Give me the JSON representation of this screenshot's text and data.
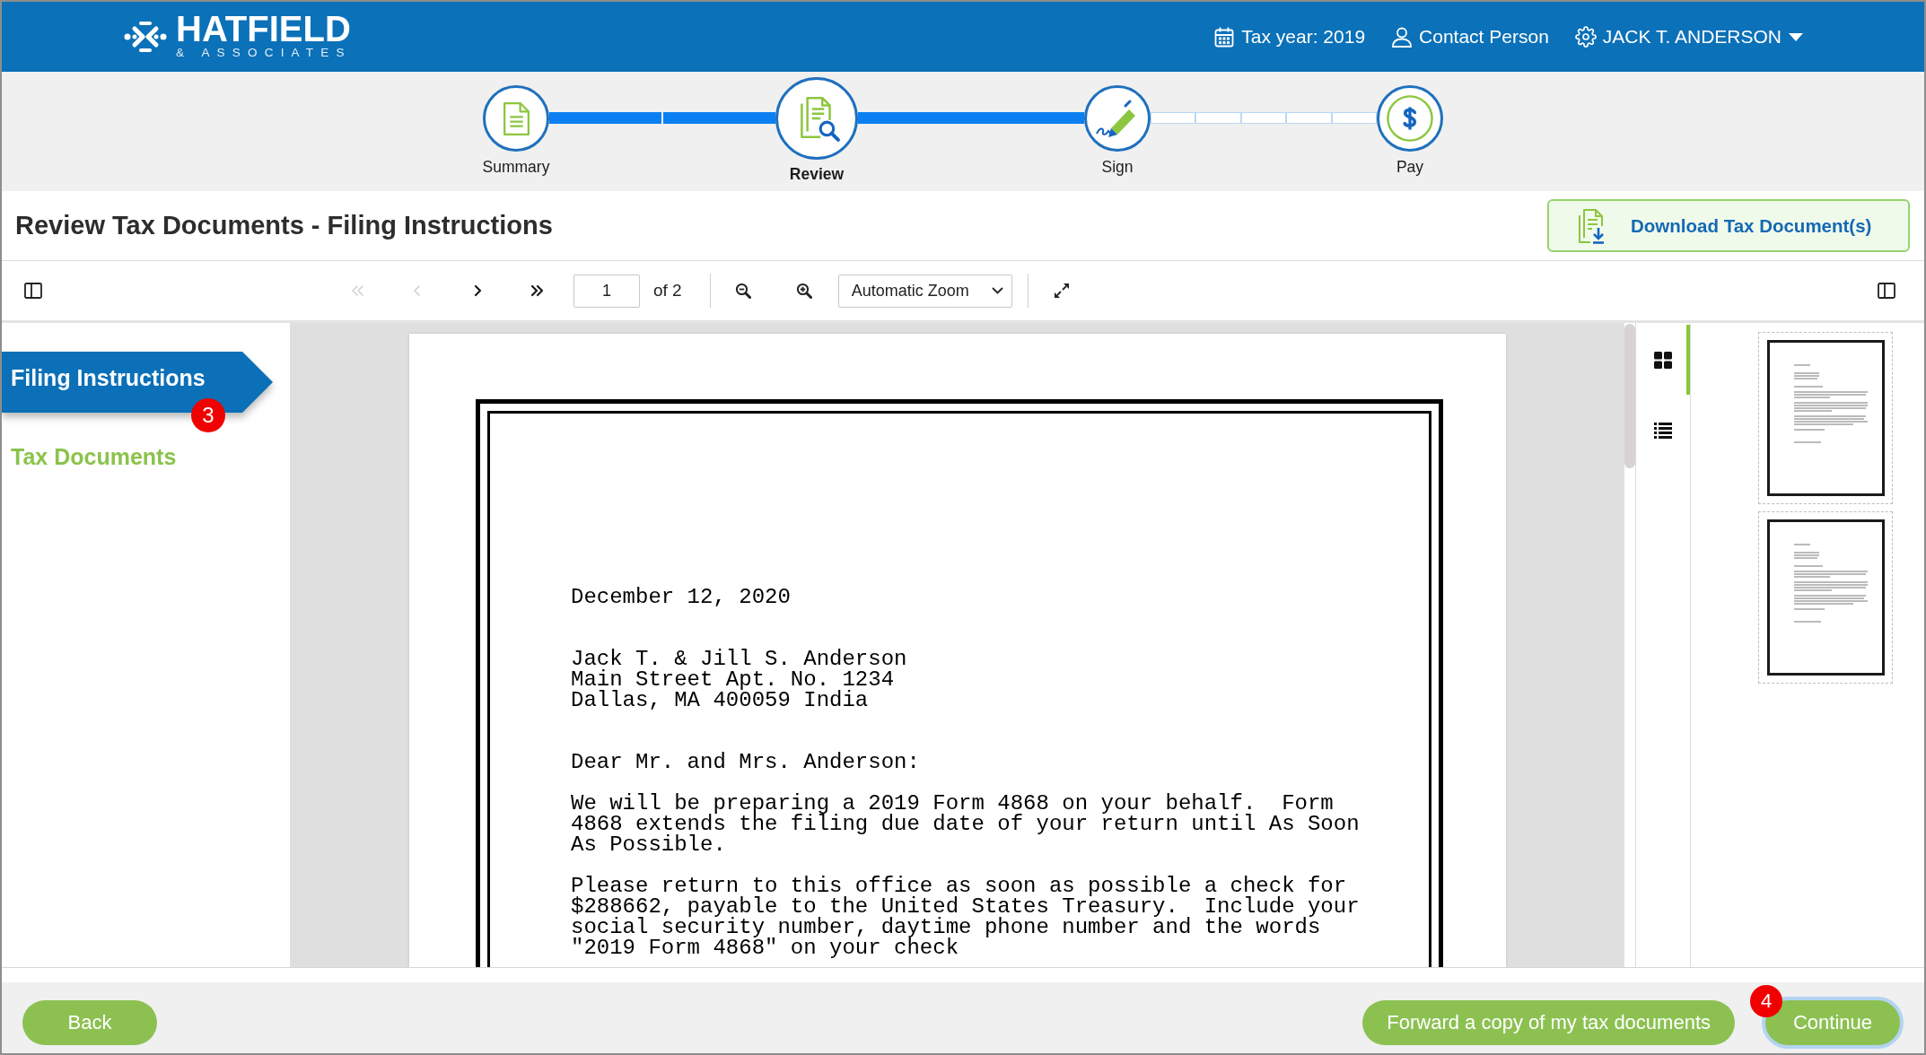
{
  "header": {
    "logo": {
      "name": "HATFIELD",
      "tagline": "& ASSOCIATES"
    },
    "tax_year": "Tax year: 2019",
    "contact": "Contact Person",
    "user": "JACK T. ANDERSON"
  },
  "steps": [
    {
      "kind": "summary",
      "label": "Summary",
      "selected": false
    },
    {
      "kind": "review",
      "label": "Review",
      "selected": true
    },
    {
      "kind": "sign",
      "label": "Sign",
      "selected": false
    },
    {
      "kind": "pay",
      "label": "Pay",
      "selected": false
    }
  ],
  "connectors": [
    {
      "filled": true
    },
    {
      "filled": true
    },
    {
      "filled": false
    }
  ],
  "page_title": "Review Tax Documents - Filing Instructions",
  "download_button": "Download Tax Document(s)",
  "viewer_toolbar": {
    "nav_buttons": [
      {
        "kind": "first",
        "disabled": true
      },
      {
        "kind": "previous",
        "disabled": true
      },
      {
        "kind": "next",
        "disabled": false
      },
      {
        "kind": "last",
        "disabled": false
      }
    ],
    "page_number": "1",
    "page_count": "of 2",
    "zoom": "Automatic Zoom"
  },
  "sidebar": [
    {
      "label": "Filing Instructions",
      "selected": true,
      "badge": "3"
    },
    {
      "label": "Tax Documents",
      "selected": false
    }
  ],
  "document": {
    "paragraphs": [
      "December 12, 2020",
      "Jack T. & Jill S. Anderson\nMain Street Apt. No. 1234\nDallas, MA 400059 India",
      "Dear Mr. and Mrs. Anderson:",
      "We will be preparing a 2019 Form 4868 on your behalf.  Form\n4868 extends the filing due date of your return until As Soon\nAs Possible.",
      "Please return to this office as soon as possible a check for\n$288662, payable to the United States Treasury.  Include your\nsocial security number, daytime phone number and the words\n\"2019 Form 4868\" on your check"
    ]
  },
  "thumbnail_views": [
    {
      "kind": "grid",
      "selected": true
    },
    {
      "kind": "list",
      "selected": false
    }
  ],
  "thumbnails": [
    {
      "selected": false
    },
    {
      "selected": false
    }
  ],
  "footer_buttons": [
    {
      "label": "Back",
      "focused": false
    },
    {
      "label": "Forward a copy of my tax documents",
      "focused": false
    },
    {
      "label": "Continue",
      "focused": true,
      "badge": "4"
    }
  ]
}
